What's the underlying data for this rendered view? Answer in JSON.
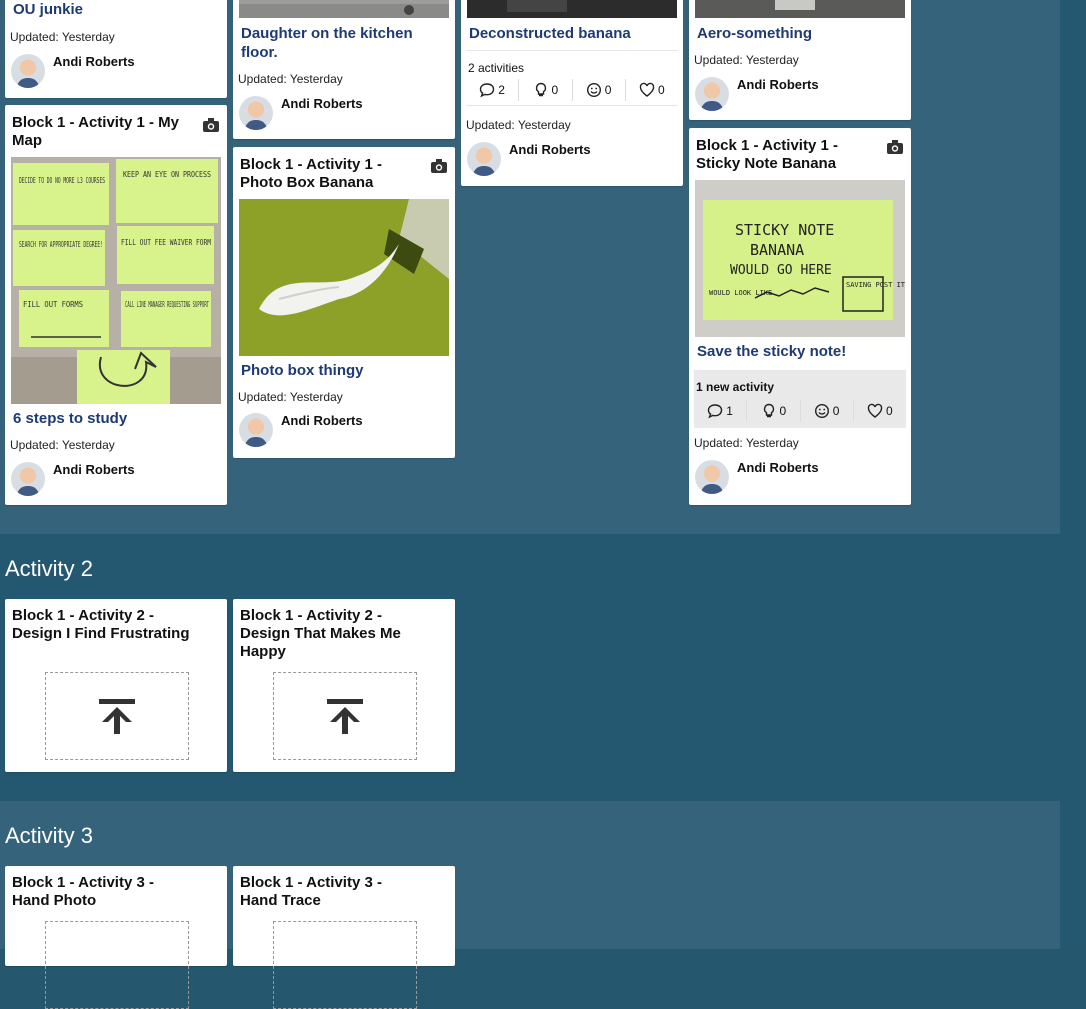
{
  "author_name": "Andi Roberts",
  "updated": "Updated: Yesterday",
  "sections": {
    "activity2": "Activity 2",
    "activity3": "Activity 3"
  },
  "cards": {
    "ou_junkie": {
      "title": "OU junkie"
    },
    "my_map": {
      "heading": "Block 1 - Activity 1 - My Map",
      "title": "6 steps to study"
    },
    "kitchen_floor": {
      "title": "Daughter on the kitchen floor."
    },
    "photo_box": {
      "heading": "Block 1 - Activity 1 - Photo Box Banana",
      "title": "Photo box thingy"
    },
    "deconstructed": {
      "title": "Deconstructed banana",
      "activity_label": "2 activities",
      "counts": {
        "comments": "2",
        "ideas": "0",
        "smiles": "0",
        "likes": "0"
      }
    },
    "aero": {
      "title": "Aero-something"
    },
    "sticky_note": {
      "heading": "Block 1 - Activity 1 - Sticky Note Banana",
      "title": "Save the sticky note!",
      "activity_label": "1 new activity",
      "counts": {
        "comments": "1",
        "ideas": "0",
        "smiles": "0",
        "likes": "0"
      }
    },
    "frustrating": {
      "heading": "Block 1 - Activity 2 - Design I Find Frustrating"
    },
    "happy": {
      "heading": "Block 1 - Activity 2 - Design That Makes Me Happy"
    },
    "hand_photo": {
      "heading": "Block 1 - Activity 3 - Hand Photo"
    },
    "hand_trace": {
      "heading": "Block 1 - Activity 3 - Hand Trace"
    }
  },
  "sticky_text": {
    "map_notes": [
      "DECIDE TO DO NO MORE L3 COURSES",
      "KEEP AN EYE ON PROCESS",
      "SEARCH FOR APPROPRIATE DEGREE!",
      "FILL OUT FEE WAIVER FORM",
      "FILL OUT FORMS",
      "CALL LINE MANAGER REQUESTING SUPPORT"
    ],
    "banana_note": [
      "STICKY NOTE",
      "BANANA",
      "WOULD GO HERE"
    ],
    "banana_small": [
      "WOULD LOOK LIKE"
    ],
    "banana_box": [
      "SAVING POST IT'S"
    ]
  },
  "icons": {
    "camera": "camera-icon",
    "comment": "comment-icon",
    "idea": "lightbulb-icon",
    "smile": "smile-icon",
    "like": "heart-icon",
    "upload": "upload-icon"
  }
}
